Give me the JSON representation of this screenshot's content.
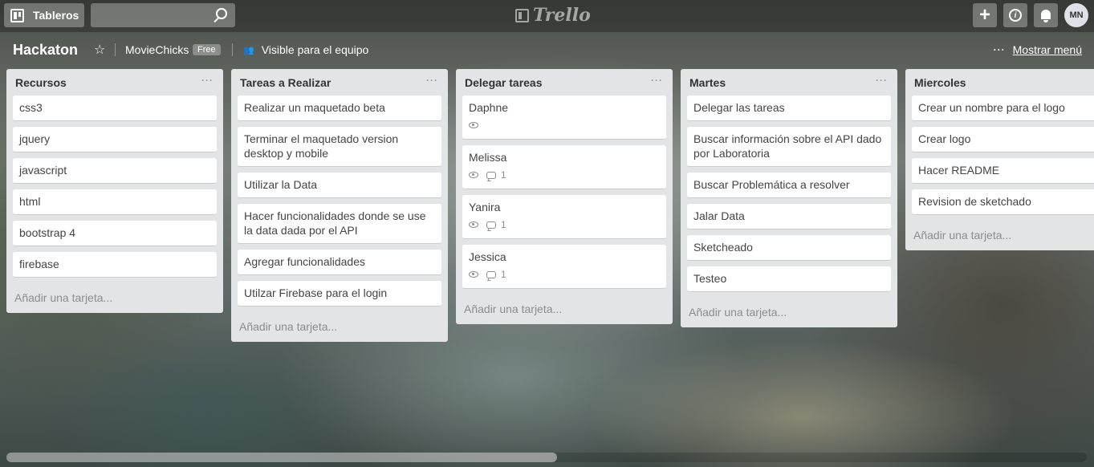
{
  "topbar": {
    "boards_label": "Tableros",
    "search_placeholder": "",
    "logo_text": "Trello",
    "avatar_initials": "MN"
  },
  "board": {
    "title": "Hackaton",
    "team_name": "MovieChicks",
    "team_plan": "Free",
    "visibility": "Visible para el equipo",
    "show_menu": "Mostrar menú"
  },
  "lists": [
    {
      "title": "Recursos",
      "cards": [
        {
          "title": "css3"
        },
        {
          "title": "jquery"
        },
        {
          "title": "javascript"
        },
        {
          "title": "html"
        },
        {
          "title": "bootstrap 4"
        },
        {
          "title": "firebase"
        }
      ],
      "add_card": "Añadir una tarjeta..."
    },
    {
      "title": "Tareas a Realizar",
      "cards": [
        {
          "title": "Realizar un maquetado beta"
        },
        {
          "title": "Terminar el maquetado version desktop y mobile"
        },
        {
          "title": "Utilizar la Data"
        },
        {
          "title": "Hacer funcionalidades donde se use la data dada por el API"
        },
        {
          "title": "Agregar funcionalidades"
        },
        {
          "title": "Utilzar Firebase para el login"
        }
      ],
      "add_card": "Añadir una tarjeta..."
    },
    {
      "title": "Delegar tareas",
      "cards": [
        {
          "title": "Daphne",
          "watched": true,
          "comments": ""
        },
        {
          "title": "Melissa",
          "watched": true,
          "comments": "1"
        },
        {
          "title": "Yanira",
          "watched": true,
          "comments": "1"
        },
        {
          "title": "Jessica",
          "watched": true,
          "comments": "1"
        }
      ],
      "add_card": "Añadir una tarjeta..."
    },
    {
      "title": "Martes",
      "cards": [
        {
          "title": "Delegar las tareas"
        },
        {
          "title": "Buscar información sobre el API dado por Laboratoria"
        },
        {
          "title": "Buscar Problemática a resolver"
        },
        {
          "title": "Jalar Data"
        },
        {
          "title": "Sketcheado"
        },
        {
          "title": "Testeo"
        }
      ],
      "add_card": "Añadir una tarjeta..."
    },
    {
      "title": "Miercoles",
      "cards": [
        {
          "title": "Crear un nombre para el logo"
        },
        {
          "title": "Crear logo"
        },
        {
          "title": "Hacer README"
        },
        {
          "title": "Revision de sketchado"
        }
      ],
      "add_card": "Añadir una tarjeta..."
    }
  ],
  "scrollbar": {
    "position_fraction": 0.0,
    "visible_fraction": 0.51
  }
}
